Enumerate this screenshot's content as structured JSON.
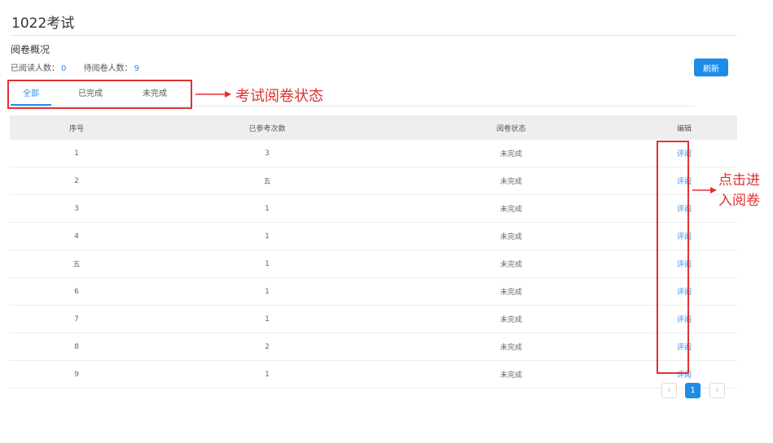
{
  "page": {
    "title": "1022考试"
  },
  "overview": {
    "title": "阅卷概况",
    "read_label": "已阅读人数：",
    "read_count": "0",
    "pending_label": "待阅卷人数：",
    "pending_count": "9",
    "refresh_label": "刷新"
  },
  "tabs": [
    {
      "label": "全部",
      "active": true
    },
    {
      "label": "已完成",
      "active": false
    },
    {
      "label": "未完成",
      "active": false
    }
  ],
  "table": {
    "headers": [
      "序号",
      "已参考次数",
      "阅卷状态",
      "编辑"
    ],
    "rows": [
      {
        "index": "1",
        "attempts": "3",
        "status": "未完成",
        "action": "评阅"
      },
      {
        "index": "2",
        "attempts": "五",
        "status": "未完成",
        "action": "评阅"
      },
      {
        "index": "3",
        "attempts": "1",
        "status": "未完成",
        "action": "评阅"
      },
      {
        "index": "4",
        "attempts": "1",
        "status": "未完成",
        "action": "评阅"
      },
      {
        "index": "五",
        "attempts": "1",
        "status": "未完成",
        "action": "评阅"
      },
      {
        "index": "6",
        "attempts": "1",
        "status": "未完成",
        "action": "评阅"
      },
      {
        "index": "7",
        "attempts": "1",
        "status": "未完成",
        "action": "评阅"
      },
      {
        "index": "8",
        "attempts": "2",
        "status": "未完成",
        "action": "评阅"
      },
      {
        "index": "9",
        "attempts": "1",
        "status": "未完成",
        "action": "评阅"
      }
    ]
  },
  "pagination": {
    "prev": "‹",
    "current": "1",
    "next": "›"
  },
  "annotations": {
    "tabs_note": "考试阅卷状态",
    "edit_note": "点击进入阅卷",
    "color": "#e03131"
  },
  "colors": {
    "accent": "#1d8ce8",
    "link": "#2d8cf0"
  }
}
